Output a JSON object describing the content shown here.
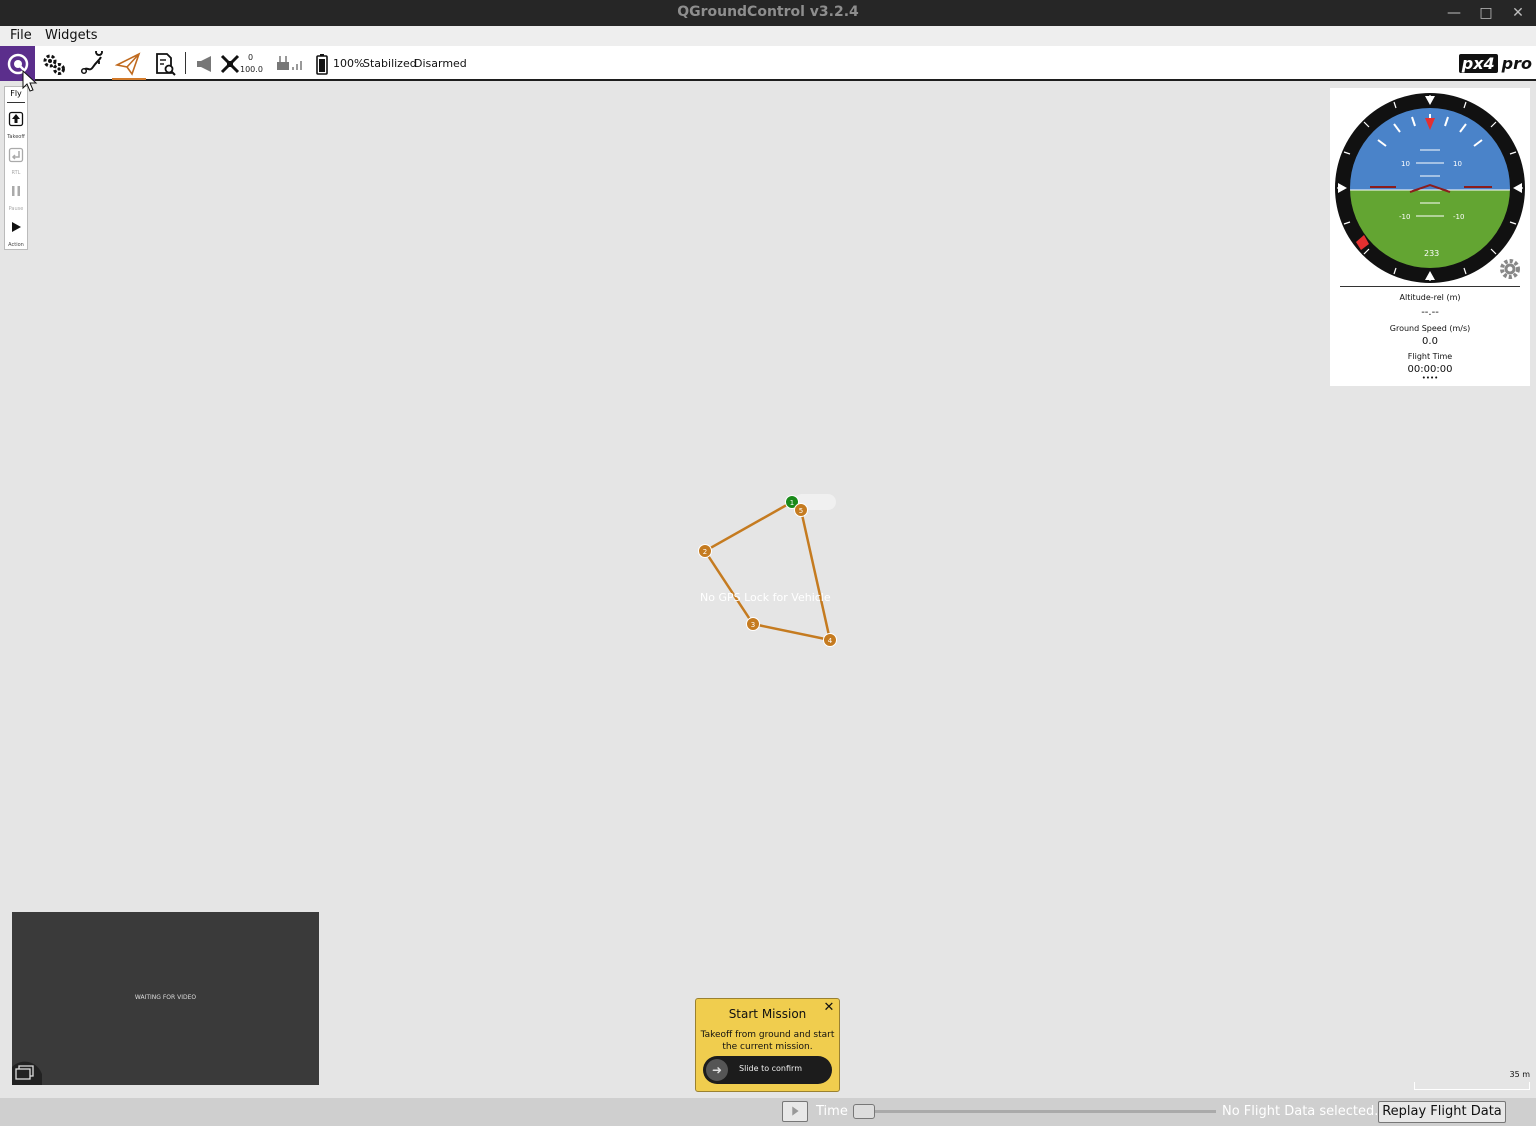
{
  "window": {
    "title": "QGroundControl v3.2.4",
    "minimize": "—",
    "maximize": "□",
    "close": "✕"
  },
  "menu": {
    "file": "File",
    "widgets": "Widgets"
  },
  "toolbar": {
    "gps_count": "0",
    "gps_hdop": "100.0",
    "battery": "100%",
    "flight_mode": "Stabilized",
    "arm_state": "Disarmed",
    "logo_box": "px4",
    "logo_text": "pro"
  },
  "flybar": {
    "fly_label": "Fly",
    "takeoff_label": "Takeoff",
    "rtl_label": "RTL",
    "pause_label": "Pause",
    "action_label": "Action"
  },
  "instrument": {
    "pitch_labels": [
      "10",
      "10",
      "-10",
      "-10"
    ],
    "heading": "233",
    "alt_label": "Altitude-rel (m)",
    "alt_value": "--.--",
    "speed_label": "Ground Speed (m/s)",
    "speed_value": "0.0",
    "time_label": "Flight Time",
    "time_value": "00:00:00",
    "more": "••••"
  },
  "map": {
    "no_gps": "No GPS Lock for Vehicle",
    "waypoints": [
      "1",
      "2",
      "3",
      "4",
      "5"
    ],
    "scale": "35 m",
    "home_color": "#1a8a1a",
    "waypoint_color": "#c57b20"
  },
  "video": {
    "message": "WAITING FOR VIDEO"
  },
  "mission": {
    "title": "Start Mission",
    "description": "Takeoff from ground and start the current mission.",
    "slide": "Slide to confirm"
  },
  "replay": {
    "time_label": "Time",
    "status": "No Flight Data selected..",
    "button": "Replay Flight Data"
  }
}
